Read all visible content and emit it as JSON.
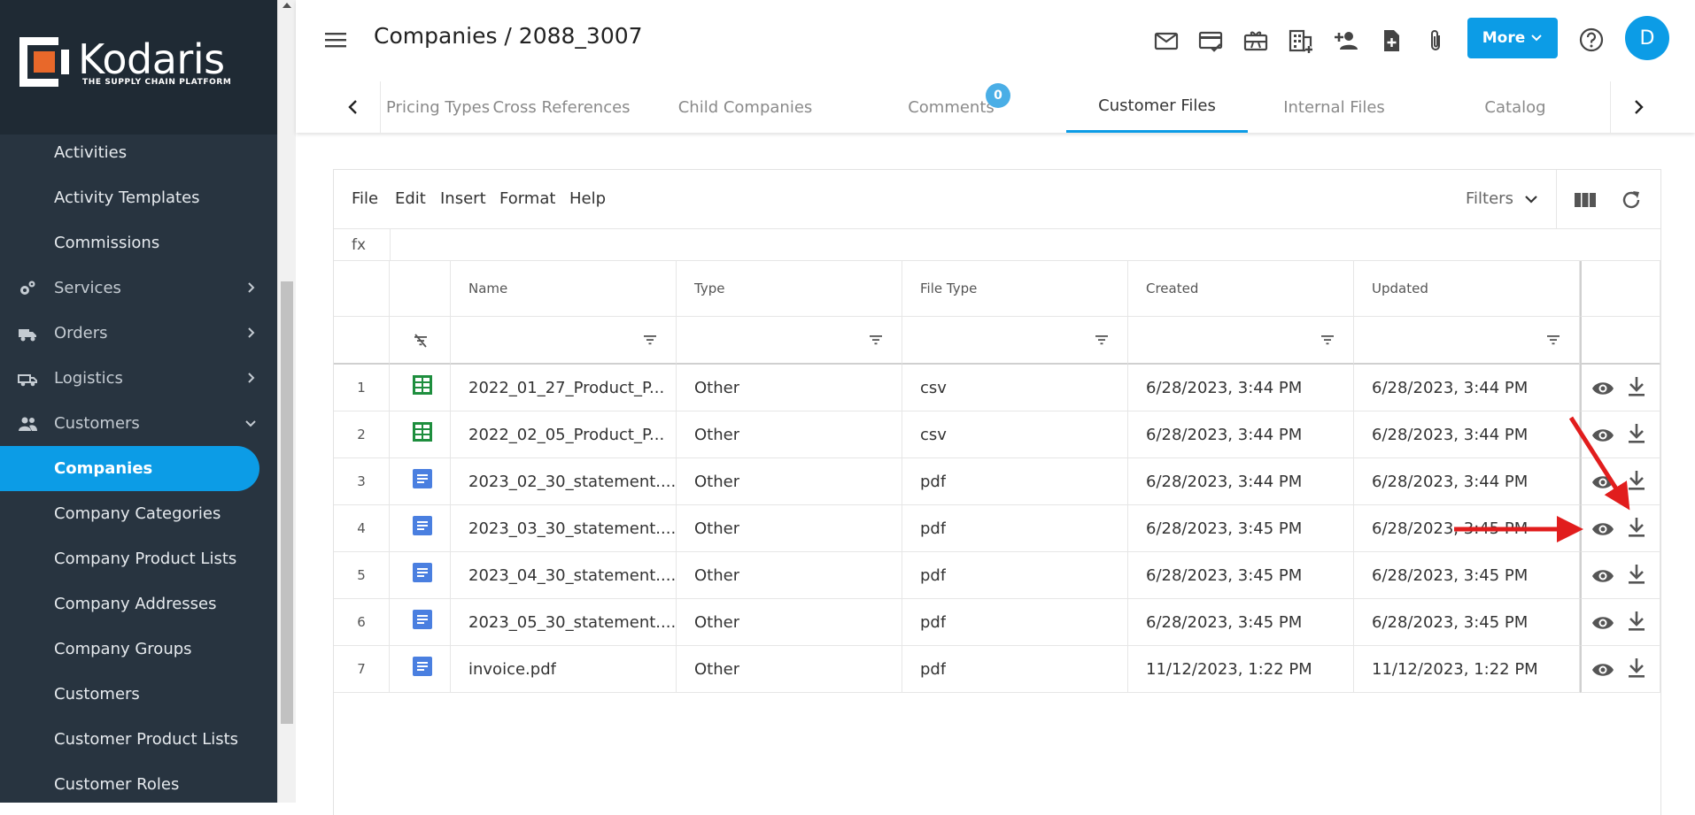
{
  "brand": {
    "name": "Kodaris",
    "tagline": "THE SUPPLY CHAIN PLATFORM",
    "accent": "#0c9ce6",
    "sidebar_bg": "#283440"
  },
  "sidebar": {
    "items": [
      {
        "label": "Activities",
        "icon": "",
        "chevron": ""
      },
      {
        "label": "Activity Templates",
        "icon": "",
        "chevron": ""
      },
      {
        "label": "Commissions",
        "icon": "",
        "chevron": ""
      },
      {
        "label": "Services",
        "icon": "gears-icon",
        "chevron": "right"
      },
      {
        "label": "Orders",
        "icon": "truck-icon",
        "chevron": "right"
      },
      {
        "label": "Logistics",
        "icon": "delivery-icon",
        "chevron": "right"
      },
      {
        "label": "Customers",
        "icon": "people-icon",
        "chevron": "down"
      },
      {
        "label": "Companies",
        "icon": "",
        "chevron": "",
        "active": true
      },
      {
        "label": "Company Categories",
        "icon": "",
        "chevron": ""
      },
      {
        "label": "Company Product Lists",
        "icon": "",
        "chevron": ""
      },
      {
        "label": "Company Addresses",
        "icon": "",
        "chevron": ""
      },
      {
        "label": "Company Groups",
        "icon": "",
        "chevron": ""
      },
      {
        "label": "Customers",
        "icon": "",
        "chevron": ""
      },
      {
        "label": "Customer Product Lists",
        "icon": "",
        "chevron": ""
      },
      {
        "label": "Customer Roles",
        "icon": "",
        "chevron": ""
      }
    ]
  },
  "header": {
    "title": "Companies / 2088_3007",
    "icons": [
      "mail-icon",
      "card-check-icon",
      "gift-card-icon",
      "building-add-icon",
      "person-add-icon",
      "file-add-icon",
      "paperclip-icon"
    ],
    "more_label": "More",
    "help_icon": "help-icon",
    "avatar_initial": "D"
  },
  "tabs": {
    "items": [
      {
        "label": "Pricing Types"
      },
      {
        "label": "Cross References"
      },
      {
        "label": "Child Companies"
      },
      {
        "label": "Comments",
        "badge": "0"
      },
      {
        "label": "Customer Files",
        "active": true
      },
      {
        "label": "Internal Files"
      },
      {
        "label": "Catalog"
      }
    ]
  },
  "sheet": {
    "menu": [
      "File",
      "Edit",
      "Insert",
      "Format",
      "Help"
    ],
    "filters_label": "Filters",
    "fx_label": "fx",
    "columns": [
      "Name",
      "Type",
      "File Type",
      "Created",
      "Updated"
    ],
    "rows": [
      {
        "num": "1",
        "icon": "spreadsheet-icon",
        "name": "2022_01_27_Product_P...",
        "type": "Other",
        "file_type": "csv",
        "created": "6/28/2023, 3:44 PM",
        "updated": "6/28/2023, 3:44 PM"
      },
      {
        "num": "2",
        "icon": "spreadsheet-icon",
        "name": "2022_02_05_Product_P...",
        "type": "Other",
        "file_type": "csv",
        "created": "6/28/2023, 3:44 PM",
        "updated": "6/28/2023, 3:44 PM"
      },
      {
        "num": "3",
        "icon": "document-icon",
        "name": "2023_02_30_statement....",
        "type": "Other",
        "file_type": "pdf",
        "created": "6/28/2023, 3:44 PM",
        "updated": "6/28/2023, 3:44 PM"
      },
      {
        "num": "4",
        "icon": "document-icon",
        "name": "2023_03_30_statement....",
        "type": "Other",
        "file_type": "pdf",
        "created": "6/28/2023, 3:45 PM",
        "updated": "6/28/2023, 3:45 PM"
      },
      {
        "num": "5",
        "icon": "document-icon",
        "name": "2023_04_30_statement....",
        "type": "Other",
        "file_type": "pdf",
        "created": "6/28/2023, 3:45 PM",
        "updated": "6/28/2023, 3:45 PM"
      },
      {
        "num": "6",
        "icon": "document-icon",
        "name": "2023_05_30_statement....",
        "type": "Other",
        "file_type": "pdf",
        "created": "6/28/2023, 3:45 PM",
        "updated": "6/28/2023, 3:45 PM"
      },
      {
        "num": "7",
        "icon": "document-icon",
        "name": "invoice.pdf",
        "type": "Other",
        "file_type": "pdf",
        "created": "11/12/2023, 1:22 PM",
        "updated": "11/12/2023, 1:22 PM"
      }
    ],
    "row_actions": [
      "view-icon",
      "download-icon"
    ]
  },
  "annotation": {
    "color": "#e11d1d"
  }
}
